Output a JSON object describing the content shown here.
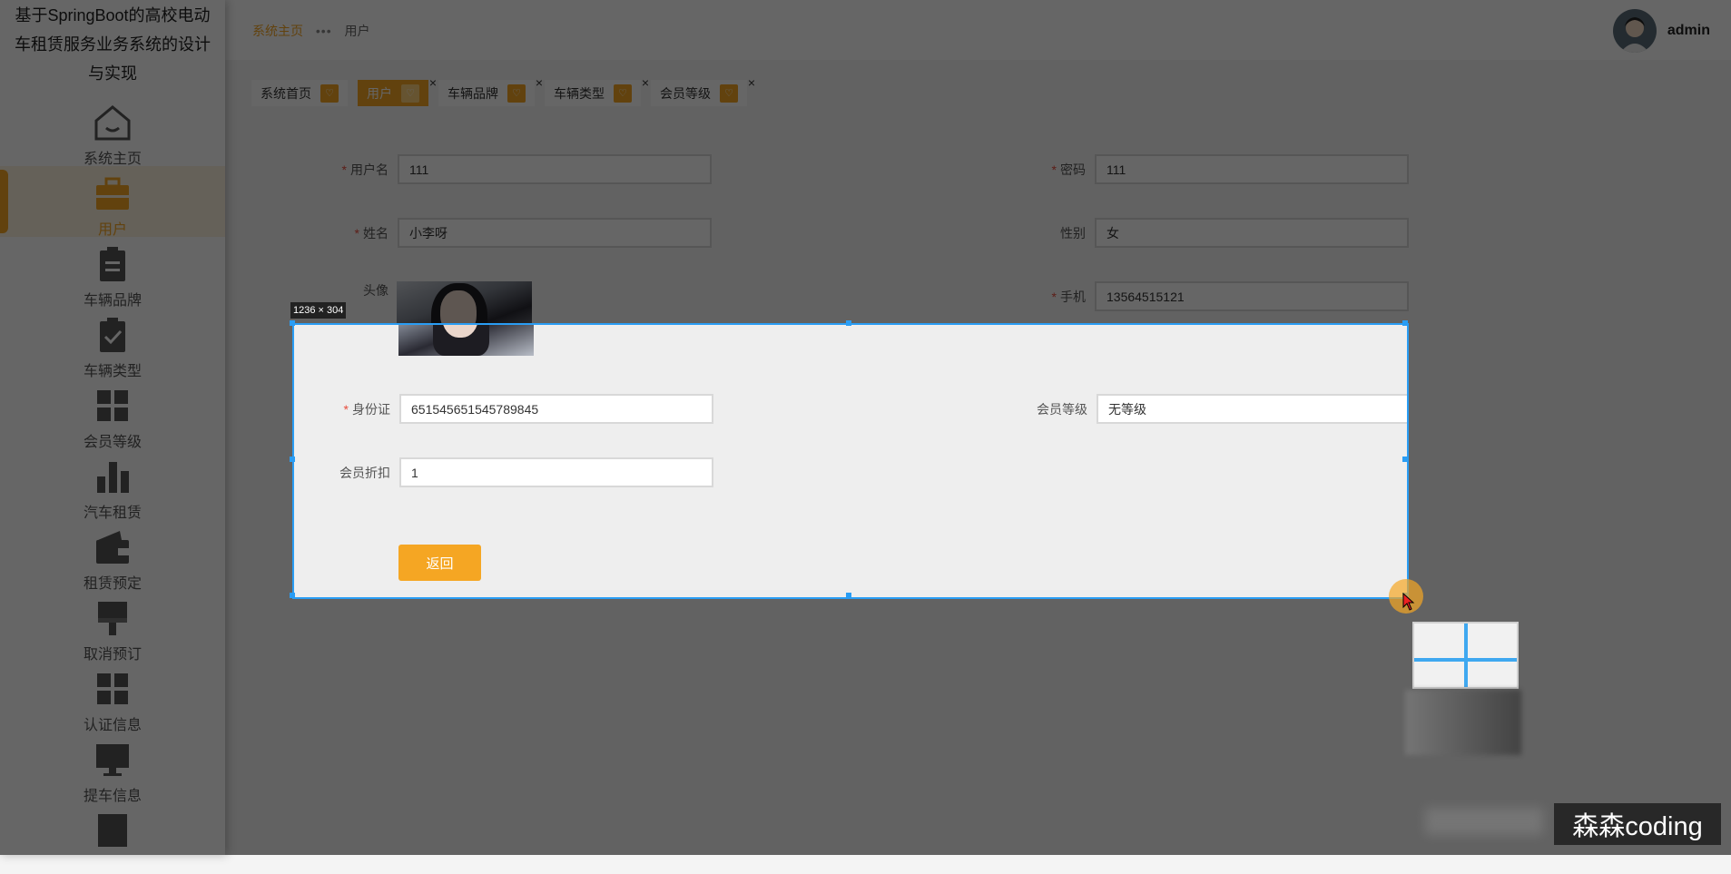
{
  "sidebar": {
    "title": "基于SpringBoot的高校电动车租赁服务业务系统的设计与实现",
    "items": [
      {
        "label": "系统主页",
        "icon": "home-icon"
      },
      {
        "label": "用户",
        "icon": "briefcase-icon",
        "active": true
      },
      {
        "label": "车辆品牌",
        "icon": "clipboard-icon"
      },
      {
        "label": "车辆类型",
        "icon": "clipboard-check-icon"
      },
      {
        "label": "会员等级",
        "icon": "grid-icon"
      },
      {
        "label": "汽车租赁",
        "icon": "bar-chart-icon"
      },
      {
        "label": "租赁预定",
        "icon": "wallet-icon"
      },
      {
        "label": "取消预订",
        "icon": "brush-icon"
      },
      {
        "label": "认证信息",
        "icon": "grid-icon"
      },
      {
        "label": "提车信息",
        "icon": "monitor-icon"
      }
    ]
  },
  "header": {
    "breadcrumb_home": "系统主页",
    "breadcrumb_sep": "•••",
    "breadcrumb_current": "用户",
    "username": "admin"
  },
  "tags": [
    {
      "label": "系统首页",
      "closable": false
    },
    {
      "label": "用户",
      "active": true,
      "closable": true
    },
    {
      "label": "车辆品牌",
      "closable": true
    },
    {
      "label": "车辆类型",
      "closable": true
    },
    {
      "label": "会员等级",
      "closable": true
    }
  ],
  "form": {
    "username_label": "用户名",
    "username_value": "111",
    "password_label": "密码",
    "password_value": "111",
    "name_label": "姓名",
    "name_value": "小李呀",
    "gender_label": "性别",
    "gender_value": "女",
    "avatar_label": "头像",
    "phone_label": "手机",
    "phone_value": "13564515121",
    "idcard_label": "身份证",
    "idcard_value": "651545651545789845",
    "level_label": "会员等级",
    "level_value": "无等级",
    "discount_label": "会员折扣",
    "discount_value": "1",
    "back_button": "返回",
    "required_mark": "*"
  },
  "overlay": {
    "selection_size": "1236 × 304",
    "watermark": "森森coding",
    "accent": "#2a9df4"
  },
  "colors": {
    "brand": "#f5a623"
  }
}
